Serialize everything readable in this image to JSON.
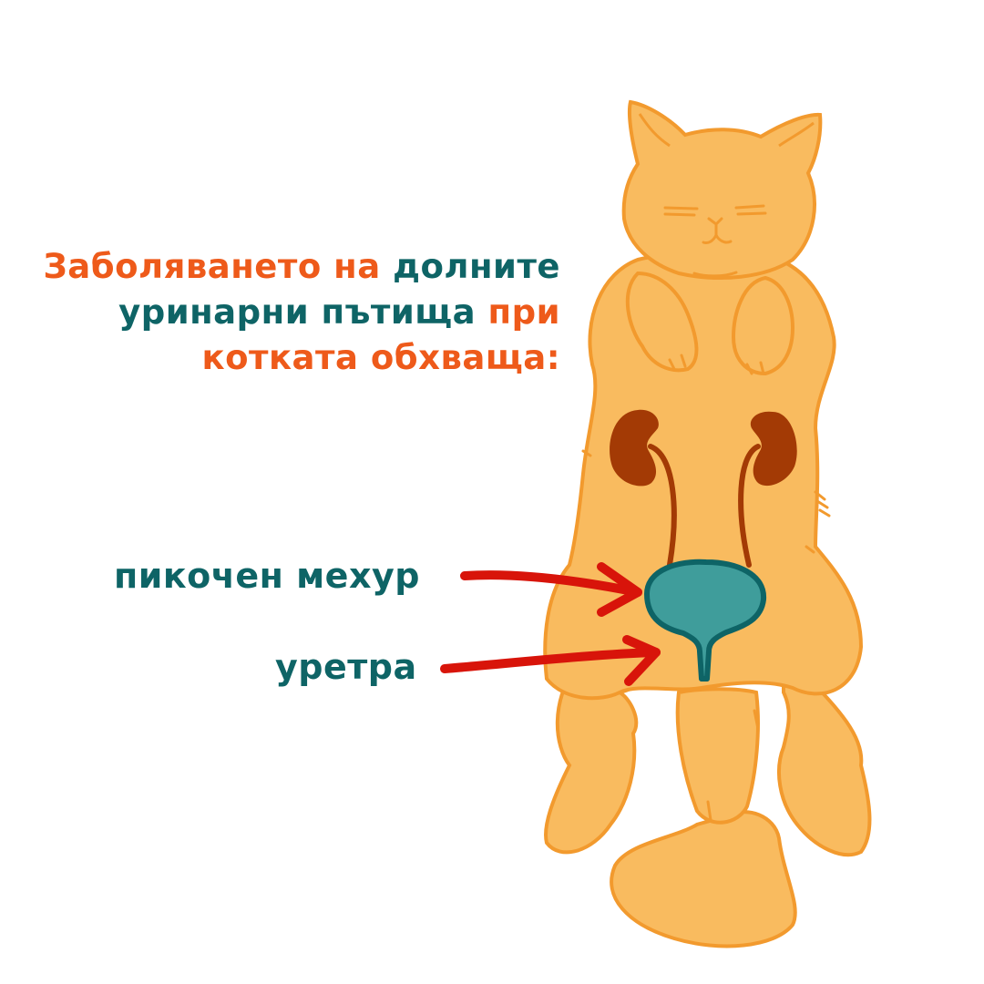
{
  "colors": {
    "background": "#ffffff",
    "accent_orange": "#ee5a1a",
    "teal": "#0e6466",
    "cat_fill": "#f9bb5f",
    "cat_outline": "#f29a2e",
    "kidney": "#a33a05",
    "bladder_fill": "#3f9d9b",
    "arrow_red": "#d8140a"
  },
  "headline": {
    "line1": {
      "orange": "Заболяването на ",
      "teal": "долните"
    },
    "line2": {
      "teal": "уринарни пътища ",
      "orange": "при"
    },
    "line3": {
      "orange": "котката обхваща:"
    }
  },
  "labels": {
    "bladder": "пикочен мехур",
    "urethra": "уретра"
  },
  "icons": [
    "cat-illustration",
    "kidney-icon",
    "bladder-icon",
    "arrow-icon"
  ]
}
